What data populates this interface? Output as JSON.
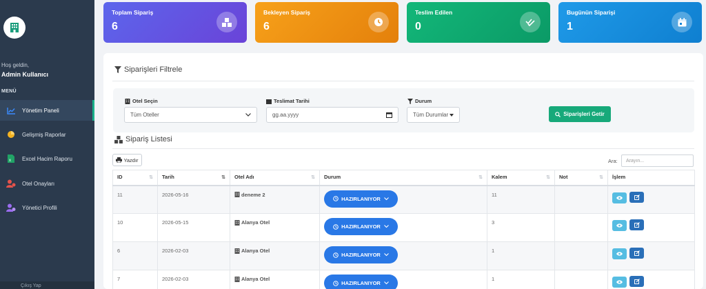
{
  "sidebar": {
    "welcome": "Hoş geldin,",
    "username": "Admin Kullanıcı",
    "menu_heading": "MENÜ",
    "items": [
      {
        "label": "Yönetim Paneli",
        "icon": "line-chart-icon",
        "active": true
      },
      {
        "label": "Gelişmiş Raporlar",
        "icon": "pie-chart-icon"
      },
      {
        "label": "Excel Hacim Raporu",
        "icon": "excel-file-icon"
      },
      {
        "label": "Otel Onayları",
        "icon": "user-check-icon"
      },
      {
        "label": "Yönetici Profili",
        "icon": "user-gear-icon"
      }
    ],
    "bottom_text": "Çıkış Yap"
  },
  "stats": [
    {
      "title": "Toplam Sipariş",
      "value": "6",
      "icon": "boxes-icon",
      "color": "#5c66ec"
    },
    {
      "title": "Bekleyen Sipariş",
      "value": "6",
      "icon": "clock-icon",
      "color": "#f7a11a"
    },
    {
      "title": "Teslim Edilen",
      "value": "0",
      "icon": "check-double-icon",
      "color": "#13b779"
    },
    {
      "title": "Bugünün Siparişi",
      "value": "1",
      "icon": "calendar-icon",
      "color": "#1f9ae8"
    }
  ],
  "filters": {
    "title": "Siparişleri Filtrele",
    "hotel_label": "Otel Seçin",
    "hotel_value": "Tüm Oteller",
    "date_label": "Teslimat Tarihi",
    "date_placeholder": "gg.aa.yyyy",
    "status_label": "Durum",
    "status_value": "Tüm Durumlar",
    "fetch_button": "Siparişleri Getir"
  },
  "list": {
    "title": "Sipariş Listesi",
    "print_button": "Yazdır",
    "search_label": "Ara:",
    "search_placeholder": "Arayın...",
    "columns": [
      "ID",
      "Tarih",
      "Otel Adı",
      "Durum",
      "Kalem",
      "Not",
      "İşlem"
    ],
    "rows": [
      {
        "id": "11",
        "date": "2026-05-16",
        "hotel": "deneme 2",
        "status": "HAZIRLANIYOR",
        "items": "11",
        "note": ""
      },
      {
        "id": "10",
        "date": "2026-05-15",
        "hotel": "Alanya Otel",
        "status": "HAZIRLANIYOR",
        "items": "3",
        "note": ""
      },
      {
        "id": "6",
        "date": "2026-02-03",
        "hotel": "Alanya Otel",
        "status": "HAZIRLANIYOR",
        "items": "1",
        "note": ""
      },
      {
        "id": "7",
        "date": "2026-02-03",
        "hotel": "Alanya Otel",
        "status": "HAZIRLANIYOR",
        "items": "1",
        "note": ""
      }
    ]
  }
}
